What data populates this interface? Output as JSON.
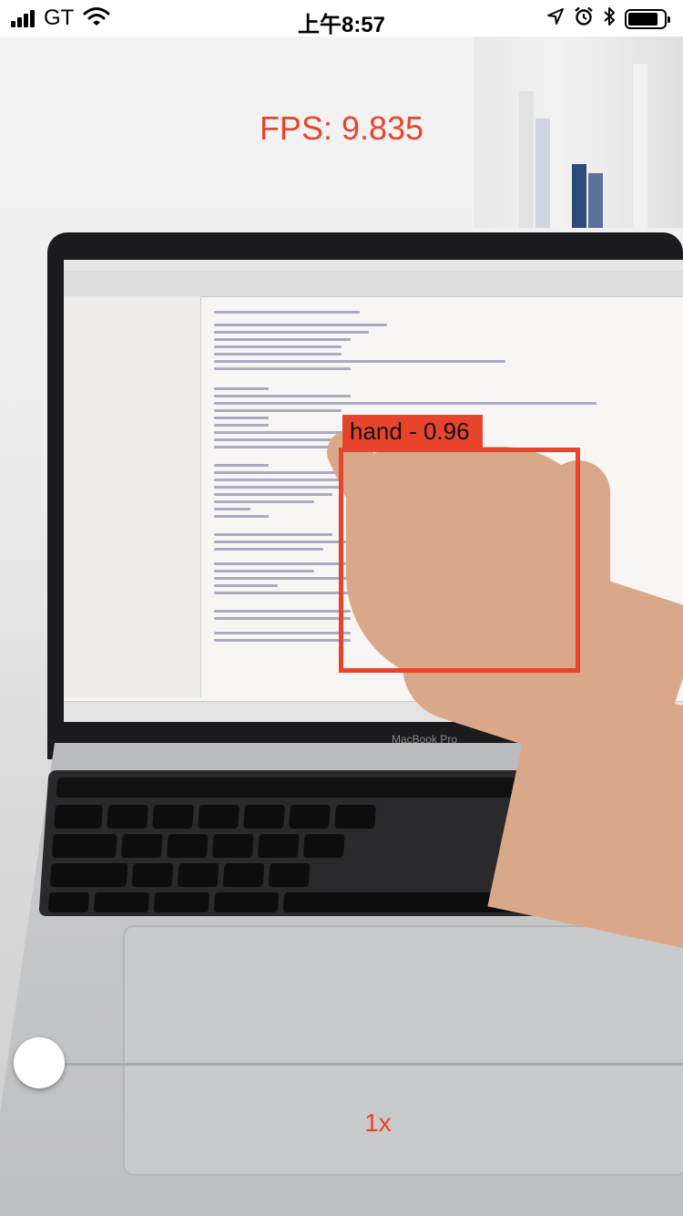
{
  "status_bar": {
    "carrier": "GT",
    "time": "上午8:57",
    "signal_bars": 4,
    "icons": [
      "signal-icon",
      "wifi-icon",
      "location-arrow-icon",
      "alarm-clock-icon",
      "bluetooth-icon",
      "battery-icon"
    ],
    "battery_level": 0.85
  },
  "overlay": {
    "fps_text": "FPS: 9.835",
    "detection_label": "hand - 0.96",
    "zoom_label": "1x",
    "zoom_slider_value": 0.0,
    "accent_color": "#e8442b"
  },
  "camera_feed": {
    "laptop_brand": "MacBook Pro"
  }
}
